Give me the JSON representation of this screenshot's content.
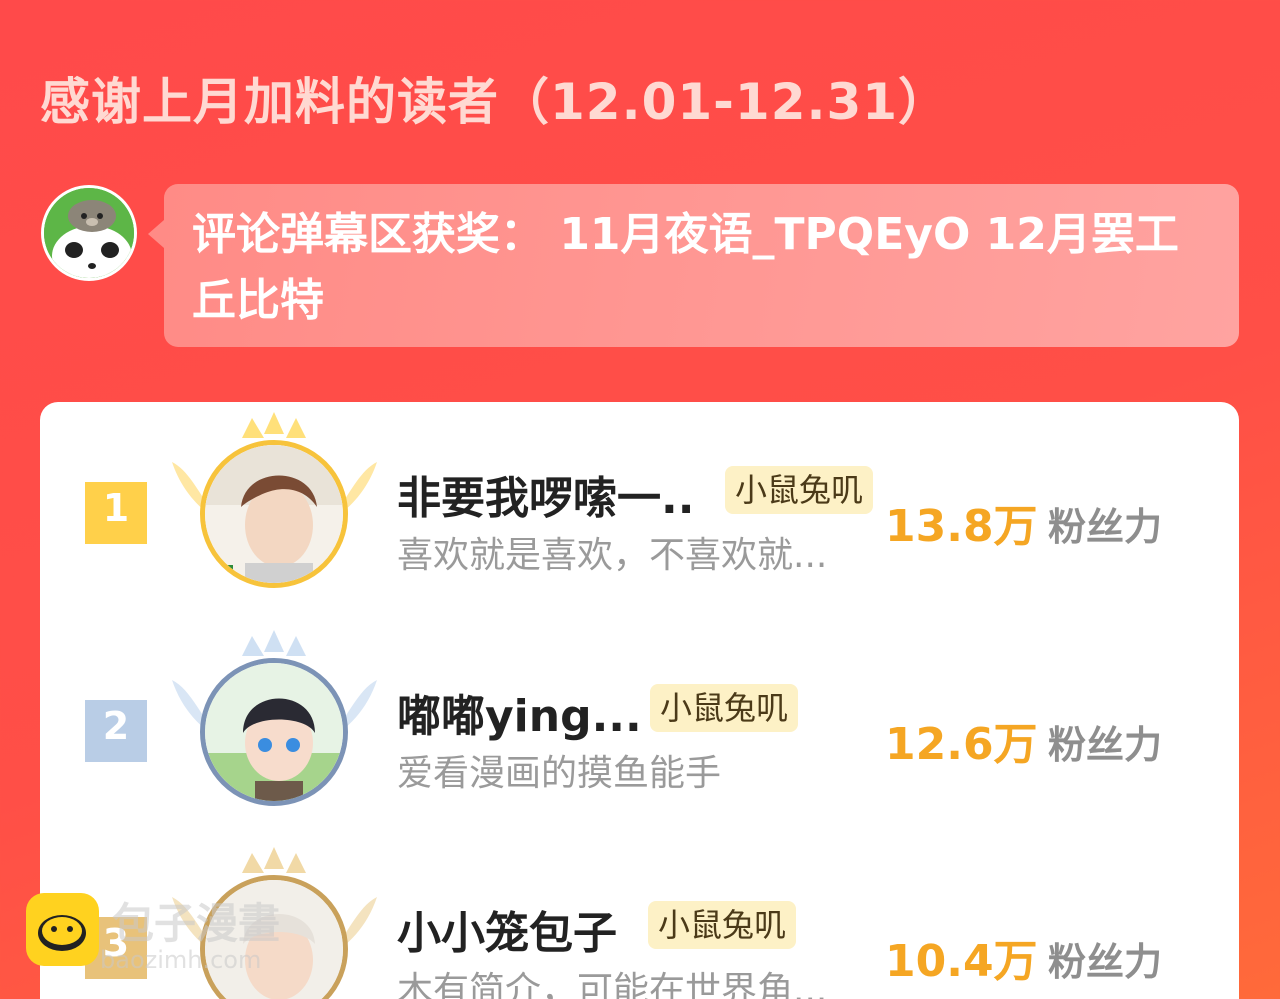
{
  "header": {
    "title": "感谢上月加料的读者（12.01-12.31）"
  },
  "award": {
    "text": "评论弹幕区获奖： 11月夜语_TPQEyO 12月罢工丘比特"
  },
  "ranking": [
    {
      "rank": "1",
      "name": "非要我啰嗦一..",
      "tag": "小鼠兔叽",
      "bio": "喜欢就是喜欢，不喜欢就...",
      "fans": "13.8万",
      "fans_label": "粉丝力",
      "rank_color": "#ffd04a",
      "ring_color": "#f7c33b"
    },
    {
      "rank": "2",
      "name": "嘟嘟ying...",
      "tag": "小鼠兔叽",
      "bio": "爱看漫画的摸鱼能手",
      "fans": "12.6万",
      "fans_label": "粉丝力",
      "rank_color": "#b9cde6",
      "ring_color": "#7c93b6"
    },
    {
      "rank": "3",
      "name": "小小笼包子",
      "tag": "小鼠兔叽",
      "bio": "木有简介，可能在世界角...",
      "fans": "10.4万",
      "fans_label": "粉丝力",
      "rank_color": "#e8c27a",
      "ring_color": "#c9a15b"
    }
  ],
  "watermark": {
    "text": "包子漫畫",
    "sub": "baozimh.com"
  }
}
